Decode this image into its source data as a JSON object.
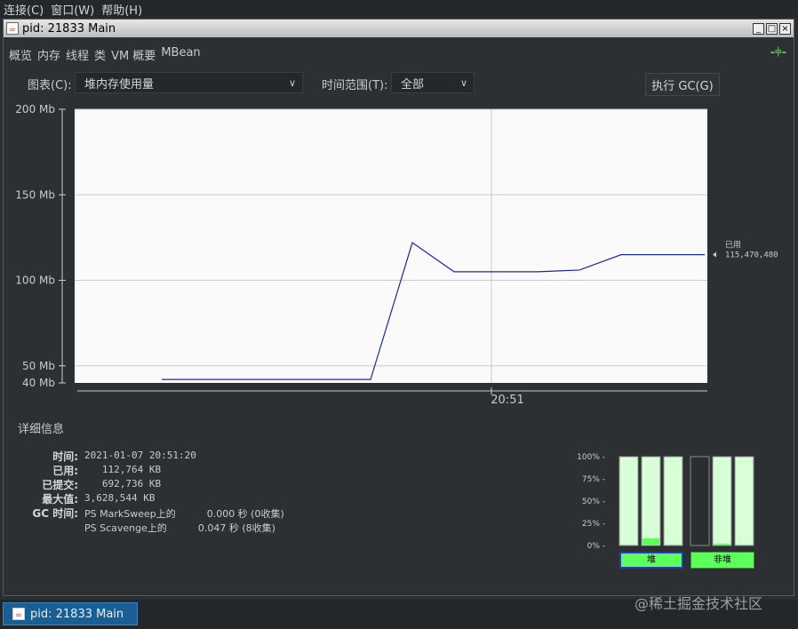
{
  "menu": [
    "连接(C)",
    "窗口(W)",
    "帮助(H)"
  ],
  "window": {
    "title": "pid: 21833 Main"
  },
  "tabs": [
    "概览",
    "内存",
    "线程",
    "类",
    "VM 概要",
    "MBean"
  ],
  "controls": {
    "chart_label": "图表(C):",
    "chart_value": "堆内存使用量",
    "range_label": "时间范围(T):",
    "range_value": "全部",
    "gc_button": "执行 GC(G)"
  },
  "chart_data": {
    "type": "line",
    "y_ticks": [
      "200 Mb",
      "150 Mb",
      "100 Mb",
      "50 Mb",
      "40 Mb"
    ],
    "y_tick_values": [
      200,
      150,
      100,
      50,
      40
    ],
    "ylim": [
      40,
      200
    ],
    "x_tick": "20:51",
    "series": [
      {
        "name": "已用",
        "color": "#1b2a9e",
        "x": [
          0,
          5,
          6,
          7,
          8,
          9,
          10,
          11,
          12,
          13
        ],
        "y": [
          42,
          42,
          122,
          105,
          105,
          105,
          106,
          115,
          115,
          115
        ]
      }
    ],
    "series_label": "已用",
    "series_value": "115,470,480"
  },
  "details": {
    "title": "详细信息",
    "time_label": "时间:",
    "time_value": "2021-01-07 20:51:20",
    "used_label": "已用:",
    "used_value": "   112,764 KB",
    "committed_label": "已提交:",
    "committed_value": "   692,736 KB",
    "max_label": "最大值:",
    "max_value": "3,628,544 KB",
    "gc_label": "GC 时间:",
    "gc_rows": [
      "PS MarkSweep上的          0.000 秒 (0收集)",
      "PS Scavenge上的          0.047 秒 (8收集)"
    ]
  },
  "pools": {
    "ticks": [
      "100% -",
      "75% -",
      "50% -",
      "25% -",
      "0% -"
    ],
    "heap_label": "堆",
    "nonheap_label": "非堆",
    "heap_fill": [
      0.0,
      0.08,
      0.01
    ],
    "nonheap_fill": [
      0.0,
      0.02,
      0.0
    ]
  },
  "taskbar": {
    "item": "pid: 21833 Main"
  },
  "watermark": "@稀土掘金技术社区"
}
